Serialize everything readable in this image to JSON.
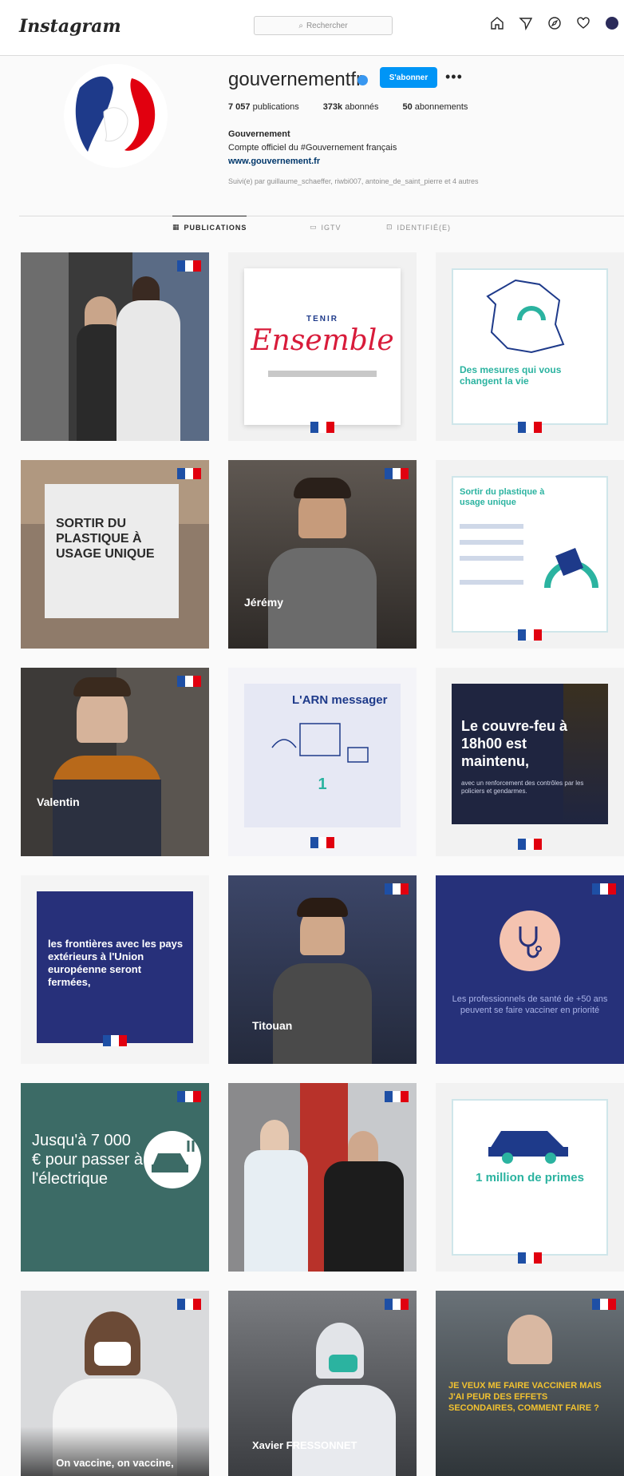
{
  "topbar": {
    "logo": "Instagram",
    "search_placeholder": "Rechercher",
    "icons": [
      "home-icon",
      "direct-icon",
      "explore-icon",
      "heart-icon",
      "profile-avatar"
    ]
  },
  "profile": {
    "username": "gouvernementfr",
    "follow_label": "S'abonner",
    "more_label": "•••",
    "stats": {
      "posts": "7 057",
      "posts_label": "publications",
      "followers": "373k",
      "followers_label": "abonnés",
      "following": "50",
      "following_label": "abonnements"
    },
    "bio_name": "Gouvernement",
    "bio_line": "Compte officiel du #Gouvernement français",
    "bio_link": "www.gouvernement.fr",
    "followed_by": "Suivi(e) par guillaume_schaeffer, riwbi007, antoine_de_saint_pierre et 4 autres"
  },
  "tabs": [
    {
      "label": "PUBLICATIONS",
      "icon": "grid-icon"
    },
    {
      "label": "IGTV",
      "icon": "igtv-icon"
    },
    {
      "label": "IDENTIFIÉ(E)",
      "icon": "tag-icon"
    }
  ],
  "posts": {
    "p2_title1": "TENIR",
    "p2_title2": "Ensemble",
    "p3_title": "Des mesures qui vous changent la vie",
    "p4_text": "SORTIR DU PLASTIQUE À USAGE UNIQUE",
    "p5_name": "Jérémy",
    "p6_title": "Sortir du plastique à usage unique",
    "p7_name": "Valentin",
    "p8_title": "L'ARN messager",
    "p8_number": "1",
    "p9_title": "Le couvre-feu à 18h00 est maintenu,",
    "p9_sub": "avec un renforcement des contrôles par les policiers et gendarmes.",
    "p10_text": "les frontières avec les pays extérieurs à l'Union européenne seront fermées,",
    "p11_name": "Titouan",
    "p12_text": "Les professionnels de santé de +50 ans peuvent se faire vacciner en priorité",
    "p13_text": "Jusqu'à 7 000 € pour passer à l'électrique",
    "p15_title": "1 million de primes",
    "p16_text": "On vaccine, on vaccine,",
    "p17_name": "Xavier FRESSONNET",
    "p18_text": "JE VEUX ME FAIRE VACCINER MAIS J'AI PEUR DES EFFETS SECONDAIRES, COMMENT FAIRE ?"
  },
  "colors": {
    "accent": "#0095f6",
    "republic_blue": "#1e4fa5",
    "republic_red": "#e1000f",
    "teal_post": "#3c6b66",
    "navy_post": "#26317a"
  }
}
